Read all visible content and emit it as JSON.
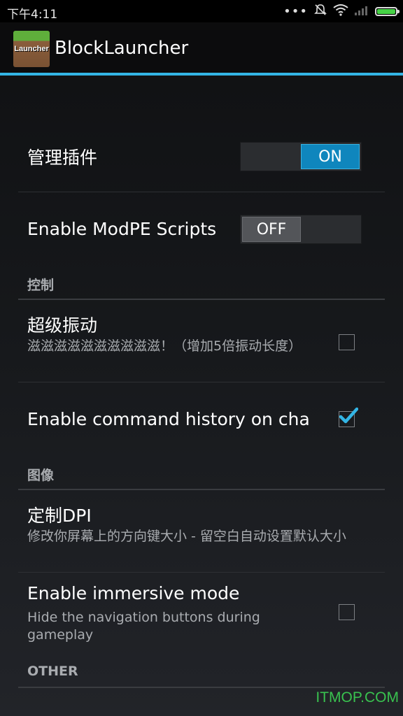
{
  "status_bar": {
    "time": "下午4:11",
    "dots": "•••",
    "battery_color": "#46d246"
  },
  "action_bar": {
    "icon_label": "Launcher",
    "title": "BlockLauncher",
    "accent": "#33b5e5"
  },
  "preferences": {
    "manage_plugins": {
      "title": "管理插件",
      "state": "ON"
    },
    "modpe_scripts": {
      "title": "Enable ModPE Scripts",
      "state": "OFF"
    },
    "category_control": "控制",
    "super_vibration": {
      "title": "超级振动",
      "summary": "滋滋滋滋滋滋滋滋滋滋！（增加5倍振动长度）",
      "checked": false
    },
    "command_history": {
      "title": "Enable command history on cha",
      "checked": true
    },
    "category_graphics": "图像",
    "custom_dpi": {
      "title": "定制DPI",
      "summary": "修改你屏幕上的方向键大小 - 留空白自动设置默认大小"
    },
    "immersive_mode": {
      "title": "Enable immersive mode",
      "summary": "Hide the navigation buttons during gameplay",
      "checked": false
    },
    "category_other": "OTHER"
  },
  "watermark": "ITMOP.COM"
}
